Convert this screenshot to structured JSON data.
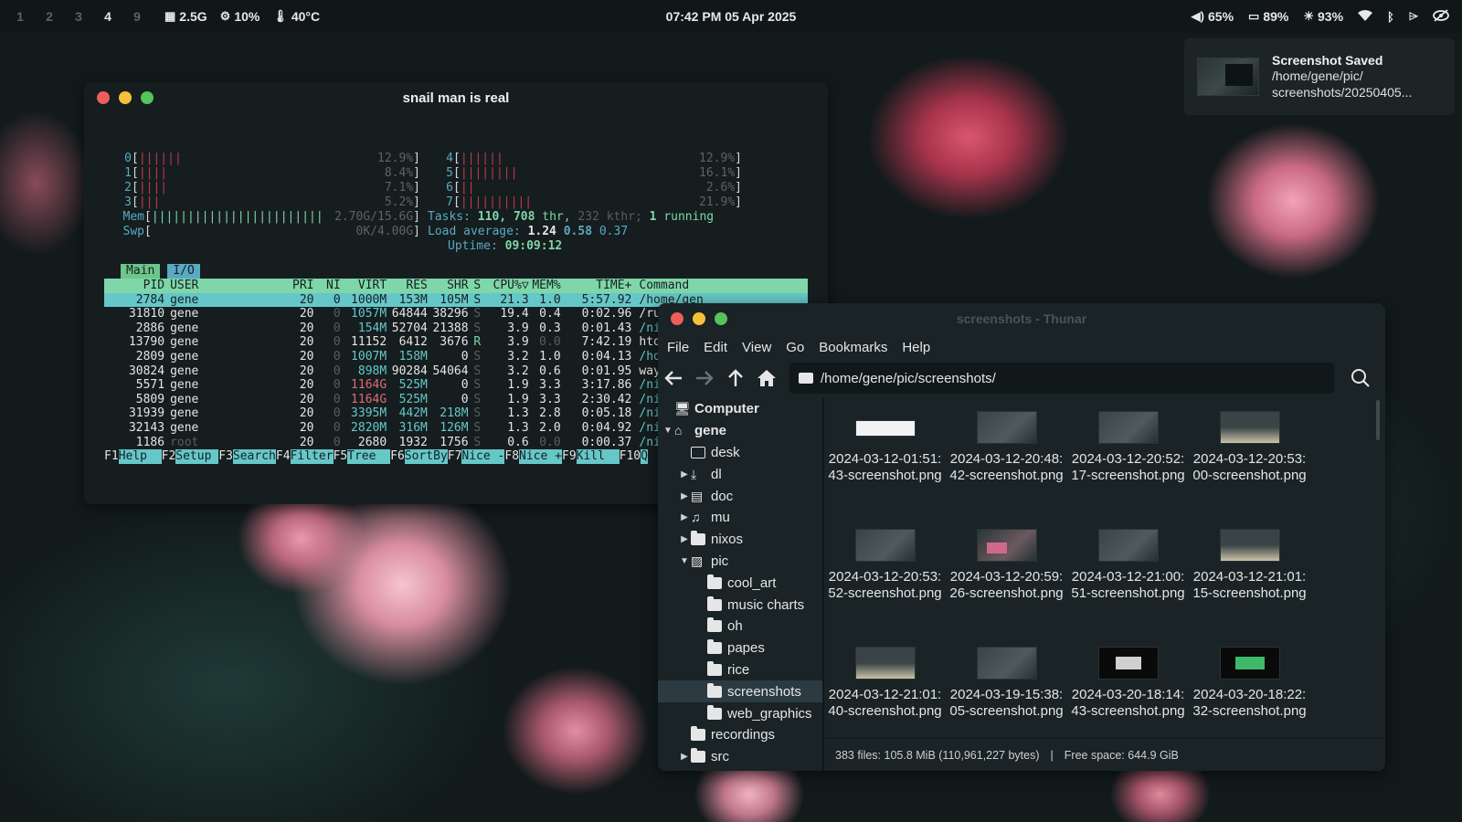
{
  "topbar": {
    "workspaces": [
      "1",
      "2",
      "3",
      "4",
      "9"
    ],
    "active_workspace": "4",
    "mem": "2.5G",
    "cpu": "10%",
    "temp": "40°C",
    "clock": "07:42 PM 05 Apr 2025",
    "volume": "65%",
    "battery": "89%",
    "brightness": "93%"
  },
  "notification": {
    "title": "Screenshot Saved",
    "line1": "/home/gene/pic/",
    "line2": "screenshots/20250405..."
  },
  "htop": {
    "title": "snail man is real",
    "cpus": [
      {
        "n": "0",
        "bars": "||||||",
        "pct": "12.9%"
      },
      {
        "n": "1",
        "bars": "||||",
        "pct": "8.4%"
      },
      {
        "n": "2",
        "bars": "||||",
        "pct": "7.1%"
      },
      {
        "n": "3",
        "bars": "|||",
        "pct": "5.2%"
      },
      {
        "n": "4",
        "bars": "||||||",
        "pct": "12.9%"
      },
      {
        "n": "5",
        "bars": "||||||||",
        "pct": "16.1%"
      },
      {
        "n": "6",
        "bars": "||",
        "pct": "2.6%"
      },
      {
        "n": "7",
        "bars": "||||||||||",
        "pct": "21.9%"
      }
    ],
    "mem_label": "Mem",
    "mem_bars": "||||||||||||||||||||||||||||",
    "mem_value": "2.70G/15.6G",
    "swp_label": "Swp",
    "swp_value": "0K/4.00G",
    "tasks_label": "Tasks:",
    "tasks": "110,",
    "threads": "708",
    "thr_label": "thr,",
    "kthr": "232 kthr;",
    "running": "1",
    "running_label": "running",
    "load_label": "Load average:",
    "load1": "1.24",
    "load5": "0.58",
    "load15": "0.37",
    "uptime_label": "Uptime:",
    "uptime": "09:09:12",
    "tabs": [
      "Main",
      "I/O"
    ],
    "columns": [
      "PID",
      "USER",
      "PRI",
      "NI",
      "VIRT",
      "RES",
      "SHR",
      "S",
      "CPU%▽",
      "MEM%",
      "TIME+",
      "Command"
    ],
    "processes": [
      {
        "pid": "2784",
        "user": "gene",
        "pri": "20",
        "ni": "0",
        "virt": "1000M",
        "res": "153M",
        "shr": "105M",
        "s": "S",
        "cpu": "21.3",
        "mem": "1.0",
        "time": "5:57.92",
        "cmd": "/home/gen"
      },
      {
        "pid": "31810",
        "user": "gene",
        "pri": "20",
        "ni": "0",
        "virt": "1057M",
        "res": "64844",
        "shr": "38296",
        "s": "S",
        "cpu": "19.4",
        "mem": "0.4",
        "time": "0:02.96",
        "cmd": "/run/curr"
      },
      {
        "pid": "2886",
        "user": "gene",
        "pri": "20",
        "ni": "0",
        "virt": "154M",
        "res": "52704",
        "shr": "21388",
        "s": "S",
        "cpu": "3.9",
        "mem": "0.3",
        "time": "0:01.43",
        "cmd": "/nix/stor"
      },
      {
        "pid": "13790",
        "user": "gene",
        "pri": "20",
        "ni": "0",
        "virt": "11152",
        "res": "6412",
        "shr": "3676",
        "s": "R",
        "cpu": "3.9",
        "mem": "0.0",
        "time": "7:42.19",
        "cmd": "htop"
      },
      {
        "pid": "2809",
        "user": "gene",
        "pri": "20",
        "ni": "0",
        "virt": "1007M",
        "res": "158M",
        "shr": "0",
        "s": "S",
        "cpu": "3.2",
        "mem": "1.0",
        "time": "0:04.13",
        "cmd": "/home/gen"
      },
      {
        "pid": "30824",
        "user": "gene",
        "pri": "20",
        "ni": "0",
        "virt": "898M",
        "res": "90284",
        "shr": "54064",
        "s": "S",
        "cpu": "3.2",
        "mem": "0.6",
        "time": "0:01.95",
        "cmd": "waybar"
      },
      {
        "pid": "5571",
        "user": "gene",
        "pri": "20",
        "ni": "0",
        "virt": "1164G",
        "res": "525M",
        "shr": "0",
        "s": "S",
        "cpu": "1.9",
        "mem": "3.3",
        "time": "3:17.86",
        "cmd": "/nix/stor"
      },
      {
        "pid": "5809",
        "user": "gene",
        "pri": "20",
        "ni": "0",
        "virt": "1164G",
        "res": "525M",
        "shr": "0",
        "s": "S",
        "cpu": "1.9",
        "mem": "3.3",
        "time": "2:30.42",
        "cmd": "/nix/stor"
      },
      {
        "pid": "31939",
        "user": "gene",
        "pri": "20",
        "ni": "0",
        "virt": "3395M",
        "res": "442M",
        "shr": "218M",
        "s": "S",
        "cpu": "1.3",
        "mem": "2.8",
        "time": "0:05.18",
        "cmd": "/nix/stor"
      },
      {
        "pid": "32143",
        "user": "gene",
        "pri": "20",
        "ni": "0",
        "virt": "2820M",
        "res": "316M",
        "shr": "126M",
        "s": "S",
        "cpu": "1.3",
        "mem": "2.0",
        "time": "0:04.92",
        "cmd": "/nix/stor"
      },
      {
        "pid": "1186",
        "user": "root",
        "pri": "20",
        "ni": "0",
        "virt": "2680",
        "res": "1932",
        "shr": "1756",
        "s": "S",
        "cpu": "0.6",
        "mem": "0.0",
        "time": "0:00.37",
        "cmd": "/nix/stor"
      }
    ],
    "fkeys": [
      {
        "k": "F1",
        "l": "Help  "
      },
      {
        "k": "F2",
        "l": "Setup "
      },
      {
        "k": "F3",
        "l": "Search"
      },
      {
        "k": "F4",
        "l": "Filter"
      },
      {
        "k": "F5",
        "l": "Tree  "
      },
      {
        "k": "F6",
        "l": "SortBy"
      },
      {
        "k": "F7",
        "l": "Nice -"
      },
      {
        "k": "F8",
        "l": "Nice +"
      },
      {
        "k": "F9",
        "l": "Kill  "
      },
      {
        "k": "F10",
        "l": "Q"
      }
    ]
  },
  "thunar": {
    "title": "screenshots - Thunar",
    "menu": [
      "File",
      "Edit",
      "View",
      "Go",
      "Bookmarks",
      "Help"
    ],
    "path": "/home/gene/pic/screenshots/",
    "sidebar": [
      {
        "label": "Computer",
        "icon": "computer-icon",
        "level": 0,
        "arrow": "",
        "bold": true
      },
      {
        "label": "gene",
        "icon": "home-icon",
        "level": 0,
        "arrow": "▼",
        "bold": true
      },
      {
        "label": "desk",
        "icon": "desktop-icon",
        "level": 1,
        "arrow": ""
      },
      {
        "label": "dl",
        "icon": "download-icon",
        "level": 1,
        "arrow": "▶"
      },
      {
        "label": "doc",
        "icon": "document-icon",
        "level": 1,
        "arrow": "▶"
      },
      {
        "label": "mu",
        "icon": "music-icon",
        "level": 1,
        "arrow": "▶"
      },
      {
        "label": "nixos",
        "icon": "folder-icon",
        "level": 1,
        "arrow": "▶"
      },
      {
        "label": "pic",
        "icon": "picture-icon",
        "level": 1,
        "arrow": "▼"
      },
      {
        "label": "cool_art",
        "icon": "folder-icon",
        "level": 2,
        "arrow": ""
      },
      {
        "label": "music charts",
        "icon": "folder-icon",
        "level": 2,
        "arrow": ""
      },
      {
        "label": "oh",
        "icon": "folder-icon",
        "level": 2,
        "arrow": ""
      },
      {
        "label": "papes",
        "icon": "folder-icon",
        "level": 2,
        "arrow": ""
      },
      {
        "label": "rice",
        "icon": "folder-icon",
        "level": 2,
        "arrow": ""
      },
      {
        "label": "screenshots",
        "icon": "folder-icon",
        "level": 2,
        "arrow": "",
        "selected": true
      },
      {
        "label": "web_graphics",
        "icon": "folder-icon",
        "level": 2,
        "arrow": ""
      },
      {
        "label": "recordings",
        "icon": "folder-icon",
        "level": 1,
        "arrow": ""
      },
      {
        "label": "src",
        "icon": "folder-icon",
        "level": 1,
        "arrow": "▶"
      }
    ],
    "files": [
      {
        "name": "2024-03-12-01:51:43-screenshot.png",
        "thumb": "white"
      },
      {
        "name": "2024-03-12-20:48:42-screenshot.png",
        "thumb": "dark"
      },
      {
        "name": "2024-03-12-20:52:17-screenshot.png",
        "thumb": "dark"
      },
      {
        "name": "2024-03-12-20:53:00-screenshot.png",
        "thumb": "sand"
      },
      {
        "name": "2024-03-12-20:53:52-screenshot.png",
        "thumb": "dark"
      },
      {
        "name": "2024-03-12-20:59:26-screenshot.png",
        "thumb": "pink"
      },
      {
        "name": "2024-03-12-21:00:51-screenshot.png",
        "thumb": "dark"
      },
      {
        "name": "2024-03-12-21:01:15-screenshot.png",
        "thumb": "sand"
      },
      {
        "name": "2024-03-12-21:01:40-screenshot.png",
        "thumb": "sand"
      },
      {
        "name": "2024-03-19-15:38:05-screenshot.png",
        "thumb": "dark"
      },
      {
        "name": "2024-03-20-18:14:43-screenshot.png",
        "thumb": "black"
      },
      {
        "name": "2024-03-20-18:22:32-screenshot.png",
        "thumb": "greenb"
      }
    ],
    "status_files": "383 files: 105.8 MiB (110,961,227 bytes)",
    "status_sep": "|",
    "status_free": "Free space: 644.9 GiB"
  }
}
